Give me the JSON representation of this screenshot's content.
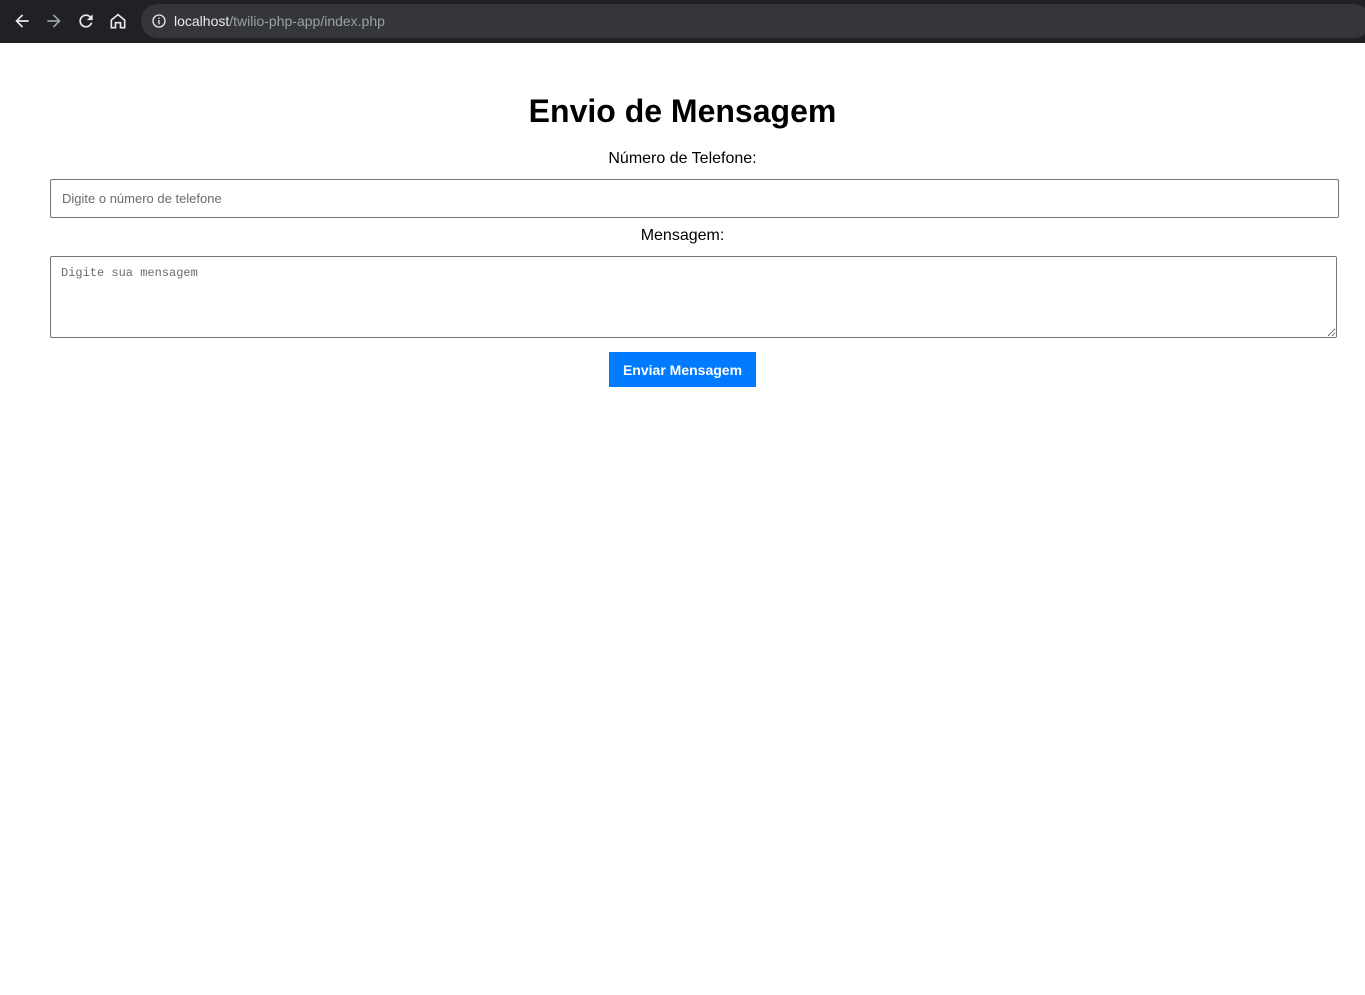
{
  "browser": {
    "url_host": "localhost",
    "url_path": "/twilio-php-app/index.php",
    "icons": [
      "back-arrow-icon",
      "forward-arrow-icon",
      "reload-icon",
      "home-icon",
      "info-icon"
    ]
  },
  "form": {
    "title": "Envio de Mensagem",
    "phone_label": "Número de Telefone:",
    "phone_placeholder": "Digite o número de telefone",
    "phone_value": "",
    "message_label": "Mensagem:",
    "message_placeholder": "Digite sua mensagem",
    "message_value": "",
    "submit_label": "Enviar Mensagem"
  },
  "colors": {
    "toolbar_bg": "#202124",
    "button_bg": "#007bff",
    "button_text": "#ffffff"
  }
}
